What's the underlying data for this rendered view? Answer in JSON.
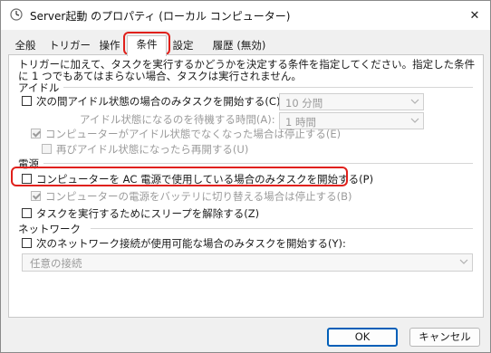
{
  "window": {
    "title": "Server起動 のプロパティ (ローカル コンピューター)",
    "app_icon": "task-scheduler-clock-icon",
    "close_glyph": "✕"
  },
  "tabs": [
    {
      "label": "全般"
    },
    {
      "label": "トリガー"
    },
    {
      "label": "操作"
    },
    {
      "label": "条件",
      "active": true
    },
    {
      "label": "設定"
    },
    {
      "label": "履歴 (無効)"
    }
  ],
  "conditions": {
    "description": "トリガーに加えて、タスクを実行するかどうかを決定する条件を指定してください。指定した条件に 1 つでもあてはまらない場合、タスクは実行されません。",
    "idle": {
      "heading": "アイドル",
      "start_if_idle": {
        "label": "次の間アイドル状態の場合のみタスクを開始する(C):",
        "checked": false
      },
      "idle_duration": "10 分間",
      "wait_label": "アイドル状態になるのを待機する時間(A):",
      "wait_value": "1 時間",
      "stop_if_not_idle": {
        "label": "コンピューターがアイドル状態でなくなった場合は停止する(E)",
        "checked": true
      },
      "restart_if_idle": {
        "label": "再びアイドル状態になったら再開する(U)",
        "checked": false
      }
    },
    "power": {
      "heading": "電源",
      "ac_only": {
        "label": "コンピューターを AC 電源で使用している場合のみタスクを開始する(P)",
        "checked": false
      },
      "stop_on_battery": {
        "label": "コンピューターの電源をバッテリに切り替える場合は停止する(B)",
        "checked": true
      },
      "wake": {
        "label": "タスクを実行するためにスリープを解除する(Z)",
        "checked": false
      }
    },
    "network": {
      "heading": "ネットワーク",
      "start_if_network": {
        "label": "次のネットワーク接続が使用可能な場合のみタスクを開始する(Y):",
        "checked": false
      },
      "connection_value": "任意の接続"
    }
  },
  "buttons": {
    "ok": "OK",
    "cancel": "キャンセル"
  },
  "colors": {
    "highlight": "#e0201b",
    "primary_border": "#005fb8"
  }
}
